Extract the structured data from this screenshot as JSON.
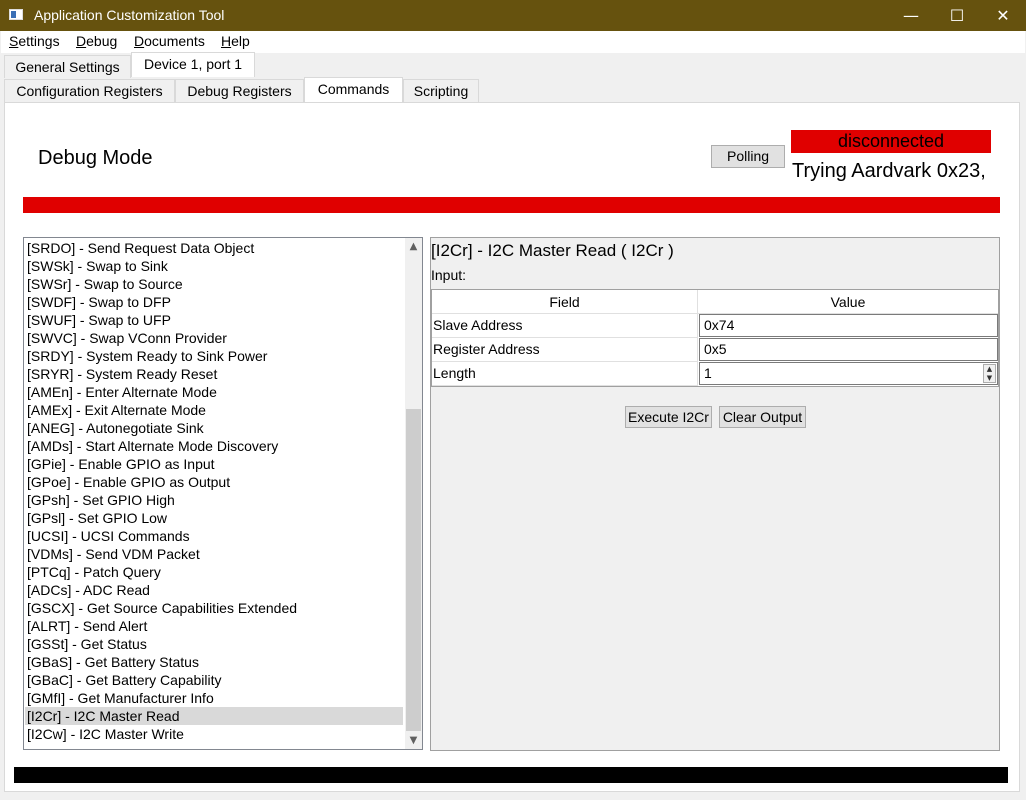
{
  "window": {
    "title": "Application Customization Tool",
    "minimize": "—",
    "maximize": "☐",
    "close": "✕"
  },
  "menu": [
    "Settings",
    "Debug",
    "Documents",
    "Help"
  ],
  "top_tabs": [
    {
      "label": "General Settings",
      "active": false
    },
    {
      "label": "Device 1, port 1",
      "active": true
    }
  ],
  "sub_tabs": [
    {
      "label": "Configuration Registers",
      "active": false
    },
    {
      "label": "Debug Registers",
      "active": false
    },
    {
      "label": "Commands",
      "active": true
    },
    {
      "label": "Scripting",
      "active": false
    }
  ],
  "header": {
    "mode_title": "Debug Mode",
    "polling_button": "Polling",
    "connection_status": "disconnected",
    "status_message": "Trying Aardvark 0x23,",
    "status_color": "#e00000"
  },
  "commands": [
    "[SRDO] - Send Request Data Object",
    "[SWSk] - Swap to Sink",
    "[SWSr] - Swap to Source",
    "[SWDF] - Swap to DFP",
    "[SWUF] - Swap to UFP",
    "[SWVC] - Swap VConn Provider",
    "[SRDY] - System Ready to Sink Power",
    "[SRYR] - System Ready Reset",
    "[AMEn] - Enter Alternate Mode",
    "[AMEx] - Exit Alternate Mode",
    "[ANEG] - Autonegotiate Sink",
    "[AMDs] - Start Alternate Mode Discovery",
    "[GPie] - Enable GPIO as Input",
    "[GPoe] - Enable GPIO as Output",
    "[GPsh] - Set GPIO High",
    "[GPsl] - Set GPIO Low",
    "[UCSI] - UCSI Commands",
    "[VDMs] - Send VDM Packet",
    "[PTCq] - Patch Query",
    "[ADCs] - ADC Read",
    "[GSCX] - Get Source Capabilities Extended",
    "[ALRT] - Send Alert",
    "[GSSt] - Get Status",
    "[GBaS] - Get Battery Status",
    "[GBaC] - Get Battery Capability",
    "[GMfI] - Get Manufacturer Info",
    "[I2Cr] - I2C Master Read",
    "[I2Cw] - I2C Master Write"
  ],
  "selected_command_index": 26,
  "detail": {
    "title": "[I2Cr] - I2C Master Read  ( I2Cr )",
    "input_label": "Input:",
    "col_field": "Field",
    "col_value": "Value",
    "params": [
      {
        "field": "Slave Address",
        "value": "0x74"
      },
      {
        "field": "Register Address",
        "value": "0x5"
      },
      {
        "field": "Length",
        "value": "1"
      }
    ],
    "execute_button": "Execute I2Cr",
    "clear_button": "Clear Output"
  }
}
